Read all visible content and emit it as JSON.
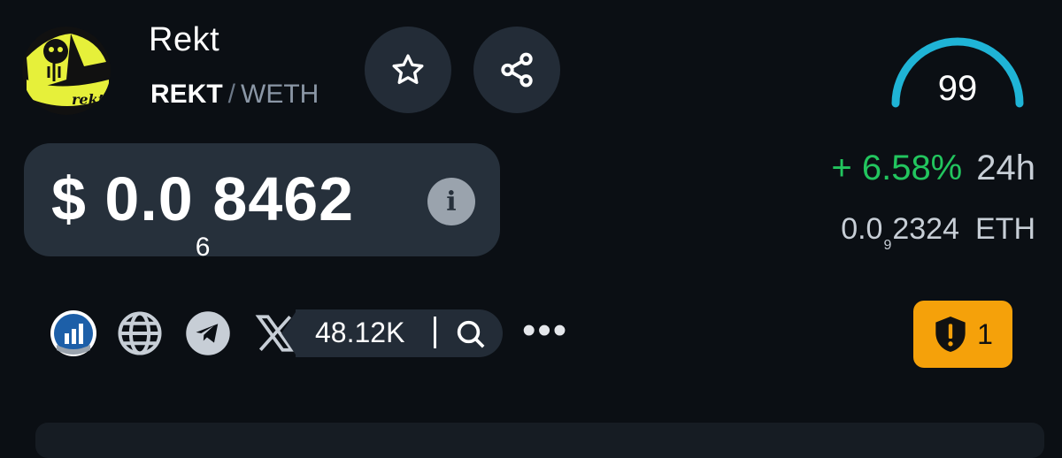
{
  "token": {
    "name": "Rekt",
    "base_symbol": "REKT",
    "separator": "/",
    "quote_symbol": "WETH",
    "avatar_text": "rekt"
  },
  "actions": {
    "favorite_icon": "star-icon",
    "share_icon": "share-icon"
  },
  "price": {
    "currency": "$",
    "prefix": "0.0",
    "zero_count": "6",
    "digits": "8462",
    "info_icon": "info-icon"
  },
  "score": {
    "value": "99",
    "fraction": 0.99,
    "color": "#1fb4d6"
  },
  "change": {
    "percent": "+ 6.58%",
    "period": "24h",
    "color": "#22c55e"
  },
  "eth_price": {
    "prefix": "0.0",
    "zero_count": "9",
    "digits": "2324",
    "unit": "ETH"
  },
  "links": {
    "icons": [
      "chart-icon",
      "globe-icon",
      "telegram-icon",
      "x-icon"
    ],
    "followers": "48.12K",
    "search_icon": "search-icon",
    "more_icon": "more-icon",
    "more_text": "•••"
  },
  "warnings": {
    "count": "1",
    "icon": "shield-warning-icon",
    "color": "#f5a10a"
  }
}
